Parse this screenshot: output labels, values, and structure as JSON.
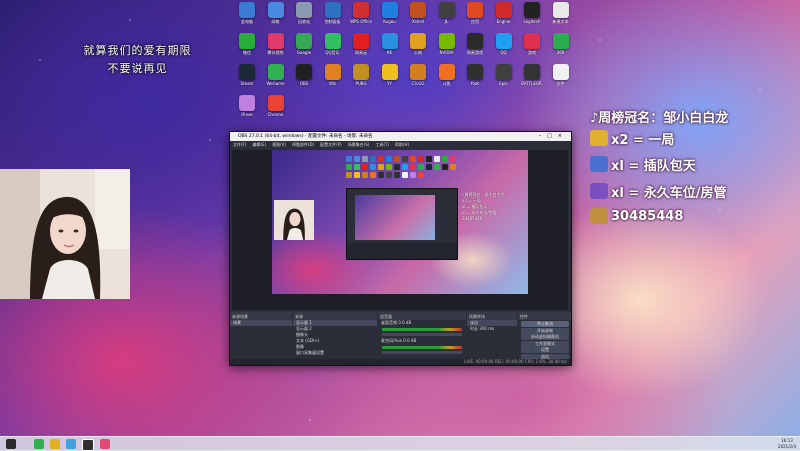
{
  "desktop": {
    "caption_line1": "就算我们的爱有期限",
    "caption_line2": "不要说再见",
    "icons": [
      {
        "label": "此电脑",
        "color": "#3a7bd5",
        "name": "this-pc-icon"
      },
      {
        "label": "网络",
        "color": "#4a8ae0",
        "name": "network-icon"
      },
      {
        "label": "回收站",
        "color": "#8a9ab0",
        "name": "recycle-bin-icon"
      },
      {
        "label": "控制面板",
        "color": "#3070c0",
        "name": "control-panel-icon"
      },
      {
        "label": "WPS Office",
        "color": "#d03030",
        "name": "wps-office-icon"
      },
      {
        "label": "Kugou",
        "color": "#2080e0",
        "name": "kugou-icon"
      },
      {
        "label": "Xshell",
        "color": "#c05020",
        "name": "xshell-icon"
      },
      {
        "label": "JL",
        "color": "#404040",
        "name": "jl-app-icon"
      },
      {
        "label": "应用",
        "color": "#e04a20",
        "name": "app-orange-icon"
      },
      {
        "label": "Engine",
        "color": "#d02a2a",
        "name": "engine-icon"
      },
      {
        "label": "Logitech",
        "color": "#222222",
        "name": "logitech-icon"
      },
      {
        "label": "新建文本",
        "color": "#e8e8e8",
        "name": "text-file-icon"
      },
      {
        "label": "微信",
        "color": "#2aae3a",
        "name": "wechat-icon"
      },
      {
        "label": "腾讯视频",
        "color": "#e03a6a",
        "name": "tencent-video-icon"
      },
      {
        "label": "Google",
        "color": "#34a853",
        "name": "chrome-icon"
      },
      {
        "label": "QQ音乐",
        "color": "#30c060",
        "name": "qq-music-icon"
      },
      {
        "label": "网易云",
        "color": "#e02020",
        "name": "netease-icon"
      },
      {
        "label": "KK",
        "color": "#2a90e0",
        "name": "kk-icon"
      },
      {
        "label": "火绒",
        "color": "#e0a020",
        "name": "huorong-icon"
      },
      {
        "label": "NVIDIA",
        "color": "#76b900",
        "name": "nvidia-icon"
      },
      {
        "label": "网易游戏",
        "color": "#2a2a2a",
        "name": "netease-game-icon"
      },
      {
        "label": "QQ",
        "color": "#20a0f0",
        "name": "qq-icon"
      },
      {
        "label": "游戏",
        "color": "#e03050",
        "name": "game-red-icon"
      },
      {
        "label": "360",
        "color": "#2aae50",
        "name": "360-icon"
      },
      {
        "label": "Steam",
        "color": "#1b2838",
        "name": "steam-icon"
      },
      {
        "label": "WeGame",
        "color": "#30b050",
        "name": "wegame-icon"
      },
      {
        "label": "OBS",
        "color": "#202020",
        "name": "obs-icon"
      },
      {
        "label": "Wiz",
        "color": "#e08020",
        "name": "wiz-icon"
      },
      {
        "label": "PUBG",
        "color": "#c09020",
        "name": "pubg-icon"
      },
      {
        "label": "YY",
        "color": "#f0c020",
        "name": "yy-icon"
      },
      {
        "label": "CS:GO",
        "color": "#d08020",
        "name": "csgo-icon"
      },
      {
        "label": "斗鱼",
        "color": "#f07020",
        "name": "douyu-icon"
      },
      {
        "label": "Riot",
        "color": "#303030",
        "name": "riot-icon"
      },
      {
        "label": "Epic",
        "color": "#404040",
        "name": "epic-icon"
      },
      {
        "label": "BATTLEGR.",
        "color": "#333333",
        "name": "battlegrounds-icon"
      },
      {
        "label": "文件",
        "color": "#f0f0f0",
        "name": "document-icon"
      },
      {
        "label": "IP.exe",
        "color": "#c080e0",
        "name": "ip-app-icon"
      },
      {
        "label": "Chrome",
        "color": "#ea4335",
        "name": "browser-icon"
      }
    ]
  },
  "overlay": {
    "rank_title": "♪周榜冠名：邹小白白龙",
    "gifts": [
      {
        "text": "x2 = 一局",
        "color": "#e0b030",
        "icon": "gift-gold-icon"
      },
      {
        "text": "xl = 插队包天",
        "color": "#4a70d0",
        "icon": "gift-plane-icon"
      },
      {
        "text": "xl = 永久车位/房管",
        "color": "#7a50c0",
        "icon": "gift-rocket-icon"
      },
      {
        "text": "30485448",
        "color": "#c09040",
        "icon": "qq-group-icon"
      }
    ]
  },
  "obs": {
    "title": "OBS 27.0.1 (64-bit, windows) - 配置文件: 未命名 - 场景: 未命名",
    "menu": [
      "文件(F)",
      "编辑(E)",
      "视图(V)",
      "停靠部件(D)",
      "配置文件(P)",
      "场景集合(S)",
      "工具(T)",
      "帮助(H)"
    ],
    "scenes_header": "来源场景",
    "scenes": [
      "场景"
    ],
    "sources_header": "来源",
    "sources": [
      "显示器 1",
      "显示器 2",
      "摄像头",
      "文本 (GDI+)",
      "图像",
      "窗口采集器设置"
    ],
    "mixer_header": "混音器",
    "mixer": [
      {
        "label": "桌面音频",
        "db": "0.0 dB"
      },
      {
        "label": "麦克风/Aux",
        "db": "0.0 dB"
      }
    ],
    "transitions_header": "场景转场",
    "transition_value": "淡出",
    "duration_label": "时长",
    "duration_value": "300 ms",
    "controls_header": "控件",
    "controls": [
      "停止推流",
      "开始录制",
      "启动虚拟摄像机",
      "工作室模式",
      "设置",
      "退出"
    ],
    "status": "LIVE: 00:00:00   REC: 00:00:00   CPU: 2.6%, 30.00 fps"
  },
  "taskbar": {
    "time": "16:13",
    "date": "2021/2/4"
  }
}
